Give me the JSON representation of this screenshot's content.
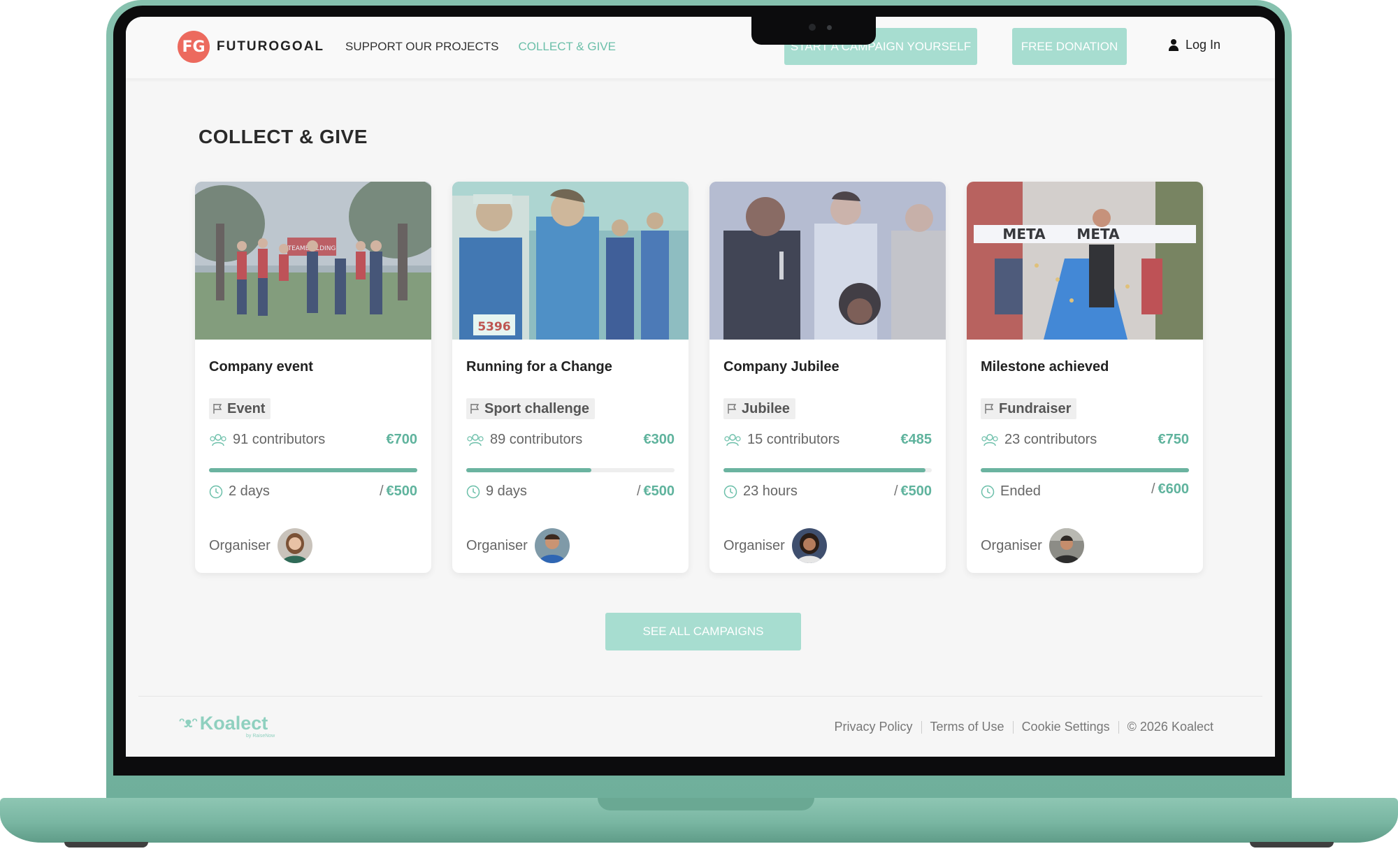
{
  "brand": {
    "name": "FUTUROGOAL",
    "logo_initials": "FG"
  },
  "nav": {
    "support": "SUPPORT OUR PROJECTS",
    "collect": "COLLECT & GIVE",
    "start_campaign": "START A CAMPAIGN YOURSELF",
    "free_donation": "FREE DONATION",
    "login": "Log In"
  },
  "section_title": "COLLECT & GIVE",
  "organiser_label": "Organiser",
  "cards": [
    {
      "title": "Company event",
      "tag": "Event",
      "contributors": "91 contributors",
      "amount": "€700",
      "progress": 1.0,
      "time": "2 days",
      "slash": "/",
      "goal": "€500"
    },
    {
      "title": "Running for a Change",
      "tag": "Sport challenge",
      "contributors": "89 contributors",
      "amount": "€300",
      "progress": 0.6,
      "time": "9 days",
      "slash": "/",
      "goal": "€500"
    },
    {
      "title": "Company Jubilee",
      "tag": "Jubilee",
      "contributors": "15 contributors",
      "amount": "€485",
      "progress": 0.97,
      "time": "23 hours",
      "slash": "/",
      "goal": "€500"
    },
    {
      "title": "Milestone achieved",
      "tag": "Fundraiser",
      "contributors": "23 contributors",
      "amount": "€750",
      "progress": 1.0,
      "time": "Ended",
      "slash": "/",
      "goal": "€600"
    }
  ],
  "image_text": {
    "banner": "TEAMBUILDING",
    "bib": "5396",
    "meta": "META"
  },
  "see_all": "SEE ALL CAMPAIGNS",
  "footer": {
    "brand": "Koalect",
    "brand_sub": "by RaiseNow",
    "privacy": "Privacy Policy",
    "terms": "Terms of Use",
    "cookies": "Cookie Settings",
    "copyright": "© 2026 Koalect"
  },
  "colors": {
    "accent": "#6bbfa9",
    "button": "#a7ddd0",
    "logo": "#ec6a5e",
    "laptop": "#7ab8a4"
  }
}
